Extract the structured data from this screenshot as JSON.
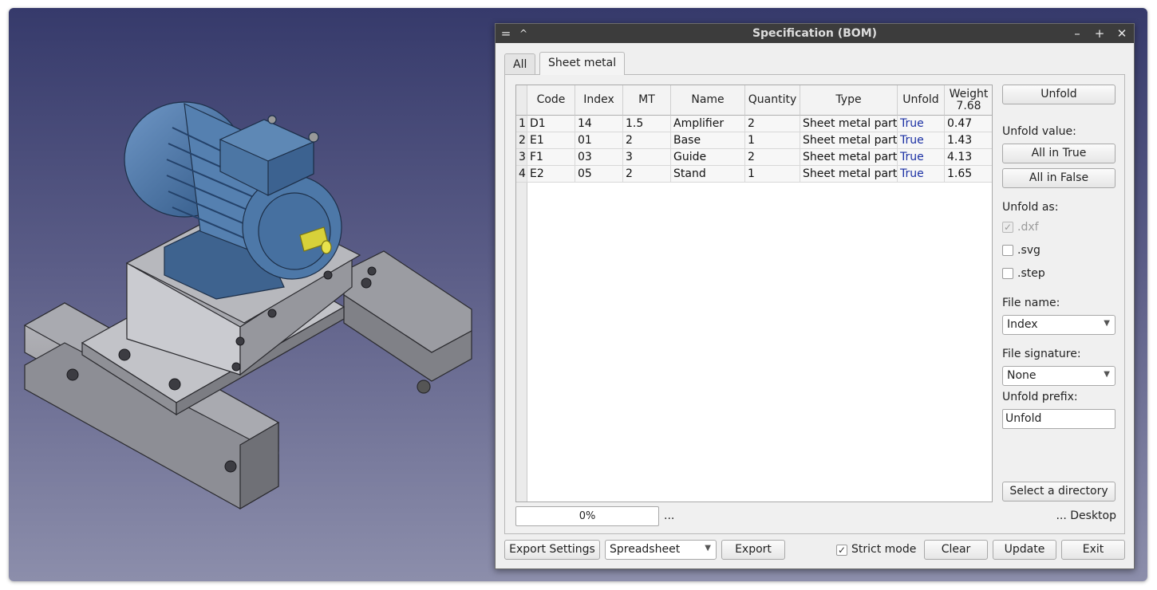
{
  "dialog": {
    "title": "Specification (BOM)",
    "tabs": [
      "All",
      "Sheet metal"
    ],
    "active_tab": "Sheet metal"
  },
  "table": {
    "columns": [
      "Code",
      "Index",
      "MT",
      "Name",
      "Quantity",
      "Type",
      "Unfold",
      "Weight\n7.68"
    ],
    "rows": [
      {
        "n": "1",
        "code": "D1",
        "index": "14",
        "mt": "1.5",
        "name": "Amplifier",
        "qty": "2",
        "type": "Sheet metal part",
        "unfold": "True",
        "weight": "0.47"
      },
      {
        "n": "2",
        "code": "E1",
        "index": "01",
        "mt": "2",
        "name": "Base",
        "qty": "1",
        "type": "Sheet metal part",
        "unfold": "True",
        "weight": "1.43"
      },
      {
        "n": "3",
        "code": "F1",
        "index": "03",
        "mt": "3",
        "name": "Guide",
        "qty": "2",
        "type": "Sheet metal part",
        "unfold": "True",
        "weight": "4.13"
      },
      {
        "n": "4",
        "code": "E2",
        "index": "05",
        "mt": "2",
        "name": "Stand",
        "qty": "1",
        "type": "Sheet metal part",
        "unfold": "True",
        "weight": "1.65"
      }
    ]
  },
  "side": {
    "unfold_button": "Unfold",
    "unfold_value_label": "Unfold value:",
    "all_true": "All in True",
    "all_false": "All in False",
    "unfold_as_label": "Unfold as:",
    "dxf": ".dxf",
    "svg": ".svg",
    "step": ".step",
    "file_name_label": "File name:",
    "file_name_value": "Index",
    "file_signature_label": "File signature:",
    "file_signature_value": "None",
    "unfold_prefix_label": "Unfold prefix:",
    "unfold_prefix_value": "Unfold",
    "select_directory": "Select a directory",
    "directory_path": "... Desktop"
  },
  "progress": {
    "text": "0%",
    "ellipsis": "..."
  },
  "bottom": {
    "export_settings": "Export Settings",
    "format_value": "Spreadsheet",
    "export": "Export",
    "strict_mode": "Strict mode",
    "clear": "Clear",
    "update": "Update",
    "exit": "Exit"
  },
  "colors": {
    "true_text": "#1a2fa3",
    "titlebar": "#3c3c3c"
  }
}
